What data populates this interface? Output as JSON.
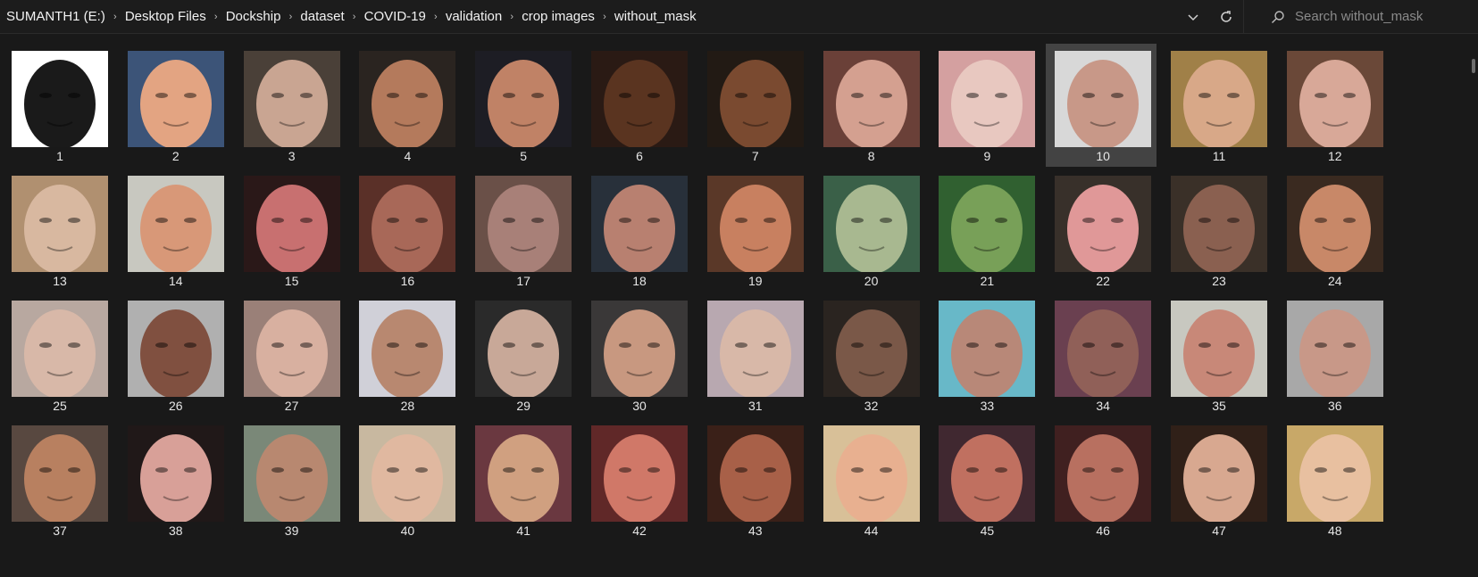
{
  "breadcrumb": [
    "SUMANTH1 (E:)",
    "Desktop Files",
    "Dockship",
    "dataset",
    "COVID-19",
    "validation",
    "crop images",
    "without_mask"
  ],
  "search": {
    "placeholder": "Search without_mask"
  },
  "icons": {
    "dropdown": "chevron-down-icon",
    "refresh": "refresh-icon",
    "search": "search-icon",
    "separator": "chevron-right-icon"
  },
  "colors": {
    "background": "#191919",
    "selected_tile": "#434343",
    "text": "#e6e6e6"
  },
  "selected_item": "10",
  "items": [
    {
      "label": "1",
      "bg": "#ffffff",
      "skin": "#1a1a1a"
    },
    {
      "label": "2",
      "bg": "#3c5478",
      "skin": "#e3a482"
    },
    {
      "label": "3",
      "bg": "#4a4038",
      "skin": "#c9a592"
    },
    {
      "label": "4",
      "bg": "#2a2420",
      "skin": "#b47a5c"
    },
    {
      "label": "5",
      "bg": "#1d1d24",
      "skin": "#c08266"
    },
    {
      "label": "6",
      "bg": "#2a1a14",
      "skin": "#5a3420"
    },
    {
      "label": "7",
      "bg": "#221a14",
      "skin": "#7a4a30"
    },
    {
      "label": "8",
      "bg": "#6a4038",
      "skin": "#d4a090"
    },
    {
      "label": "9",
      "bg": "#d4a0a0",
      "skin": "#e8c8c0"
    },
    {
      "label": "10",
      "bg": "#d8d8d8",
      "skin": "#c89888"
    },
    {
      "label": "11",
      "bg": "#a08048",
      "skin": "#d8a888"
    },
    {
      "label": "12",
      "bg": "#6a4838",
      "skin": "#d8a898"
    },
    {
      "label": "13",
      "bg": "#b09070",
      "skin": "#d8b8a0"
    },
    {
      "label": "14",
      "bg": "#c8c8c0",
      "skin": "#d89878"
    },
    {
      "label": "15",
      "bg": "#2a1818",
      "skin": "#c87070"
    },
    {
      "label": "16",
      "bg": "#5a3028",
      "skin": "#a86858"
    },
    {
      "label": "17",
      "bg": "#6a5048",
      "skin": "#a88078"
    },
    {
      "label": "18",
      "bg": "#28303a",
      "skin": "#b88070"
    },
    {
      "label": "19",
      "bg": "#5a3828",
      "skin": "#c88060"
    },
    {
      "label": "20",
      "bg": "#3a6048",
      "skin": "#a8b890"
    },
    {
      "label": "21",
      "bg": "#306030",
      "skin": "#78a058"
    },
    {
      "label": "22",
      "bg": "#38302a",
      "skin": "#e09898"
    },
    {
      "label": "23",
      "bg": "#3a3028",
      "skin": "#8a6050"
    },
    {
      "label": "24",
      "bg": "#3a2a20",
      "skin": "#c88868"
    },
    {
      "label": "25",
      "bg": "#b8a8a0",
      "skin": "#d8b8a8"
    },
    {
      "label": "26",
      "bg": "#b0b0b0",
      "skin": "#805040"
    },
    {
      "label": "27",
      "bg": "#9a8078",
      "skin": "#d8b0a0"
    },
    {
      "label": "28",
      "bg": "#d0d0d8",
      "skin": "#b88870"
    },
    {
      "label": "29",
      "bg": "#2a2a2a",
      "skin": "#c8a898"
    },
    {
      "label": "30",
      "bg": "#3a3838",
      "skin": "#c89880"
    },
    {
      "label": "31",
      "bg": "#b8a8b0",
      "skin": "#d8b8a8"
    },
    {
      "label": "32",
      "bg": "#2a2420",
      "skin": "#7a5848"
    },
    {
      "label": "33",
      "bg": "#68b8c8",
      "skin": "#b88878"
    },
    {
      "label": "34",
      "bg": "#6a4050",
      "skin": "#906058"
    },
    {
      "label": "35",
      "bg": "#c8c8c0",
      "skin": "#c88878"
    },
    {
      "label": "36",
      "bg": "#a8a8a8",
      "skin": "#c89888"
    },
    {
      "label": "37",
      "bg": "#584840",
      "skin": "#b88060"
    },
    {
      "label": "38",
      "bg": "#201818",
      "skin": "#d8a098"
    },
    {
      "label": "39",
      "bg": "#7a8878",
      "skin": "#b88870"
    },
    {
      "label": "40",
      "bg": "#c8b8a0",
      "skin": "#e0b8a0"
    },
    {
      "label": "41",
      "bg": "#6a3840",
      "skin": "#d0a080"
    },
    {
      "label": "42",
      "bg": "#602828",
      "skin": "#d07868"
    },
    {
      "label": "43",
      "bg": "#3a2018",
      "skin": "#a86048"
    },
    {
      "label": "44",
      "bg": "#d8c098",
      "skin": "#e8b090"
    },
    {
      "label": "45",
      "bg": "#402830",
      "skin": "#c07060"
    },
    {
      "label": "46",
      "bg": "#402020",
      "skin": "#b87060"
    },
    {
      "label": "47",
      "bg": "#302018",
      "skin": "#d8a890"
    },
    {
      "label": "48",
      "bg": "#c8a868",
      "skin": "#e8c0a0"
    }
  ]
}
